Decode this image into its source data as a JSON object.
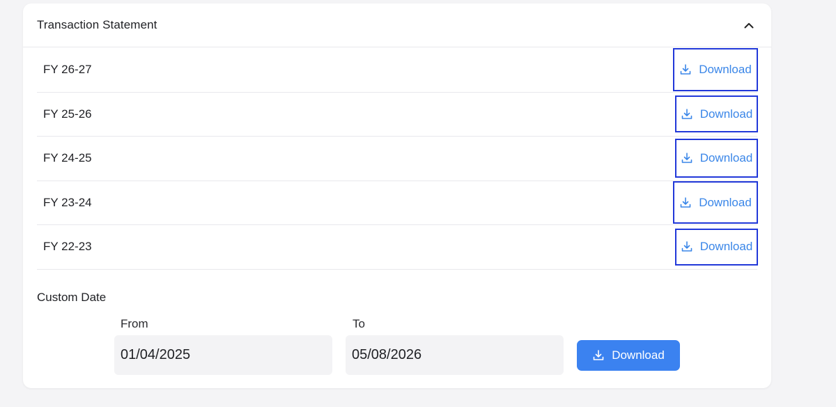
{
  "header": {
    "title": "Transaction Statement",
    "collapse_icon": "chevron-up-icon"
  },
  "statements": [
    {
      "label": "FY 26-27",
      "action": "Download"
    },
    {
      "label": "FY 25-26",
      "action": "Download"
    },
    {
      "label": "FY 24-25",
      "action": "Download"
    },
    {
      "label": "FY 23-24",
      "action": "Download"
    },
    {
      "label": "FY 22-23",
      "action": "Download"
    }
  ],
  "custom": {
    "title": "Custom Date",
    "from_label": "From",
    "from_value": "01/04/2025",
    "to_label": "To",
    "to_value": "05/08/2026",
    "button_label": "Download",
    "button_icon": "download-icon"
  },
  "colors": {
    "accent": "#3b82f0",
    "link": "#3a86e8",
    "highlight_border": "#2138d9"
  }
}
